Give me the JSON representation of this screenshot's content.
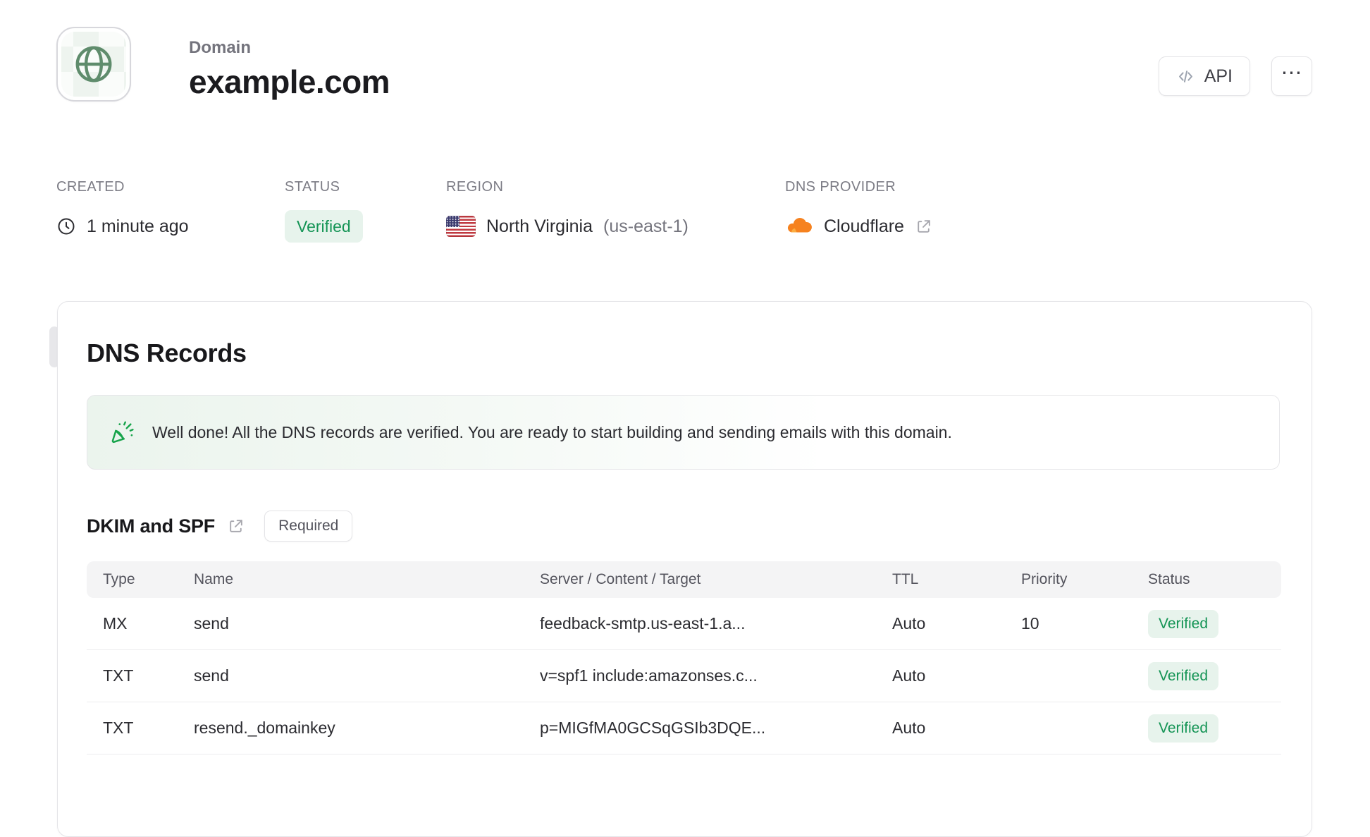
{
  "header": {
    "eyebrow": "Domain",
    "title": "example.com",
    "api_button_label": "API",
    "ellipsis_glyph": "⋯"
  },
  "meta": {
    "created": {
      "label": "CREATED",
      "value": "1 minute ago"
    },
    "status": {
      "label": "STATUS",
      "badge": "Verified"
    },
    "region": {
      "label": "REGION",
      "name": "North Virginia",
      "code": "(us-east-1)"
    },
    "dns_provider": {
      "label": "DNS PROVIDER",
      "name": "Cloudflare"
    }
  },
  "dns_card": {
    "title": "DNS Records",
    "banner_message": "Well done! All the DNS records are verified. You are ready to start building and sending emails with this domain.",
    "dkim_section": {
      "title": "DKIM and SPF",
      "badge": "Required"
    },
    "table": {
      "headers": [
        "Type",
        "Name",
        "Server / Content / Target",
        "TTL",
        "Priority",
        "Status"
      ],
      "rows": [
        {
          "type": "MX",
          "name": "send",
          "content": "feedback-smtp.us-east-1.a...",
          "ttl": "Auto",
          "priority": "10",
          "status": "Verified"
        },
        {
          "type": "TXT",
          "name": "send",
          "content": "v=spf1 include:amazonses.c...",
          "ttl": "Auto",
          "priority": "",
          "status": "Verified"
        },
        {
          "type": "TXT",
          "name": "resend._domainkey",
          "content": "p=MIGfMA0GCSqGSIb3DQE...",
          "ttl": "Auto",
          "priority": "",
          "status": "Verified"
        }
      ]
    }
  },
  "colors": {
    "verified_text": "#149455",
    "verified_bg": "#e7f3ec",
    "globe_green": "#5f8c6c",
    "banner_icon_green": "#16a34a",
    "cloudflare_orange": "#f6821f",
    "flag_red": "#c03a41",
    "flag_blue": "#3a3a6e"
  }
}
